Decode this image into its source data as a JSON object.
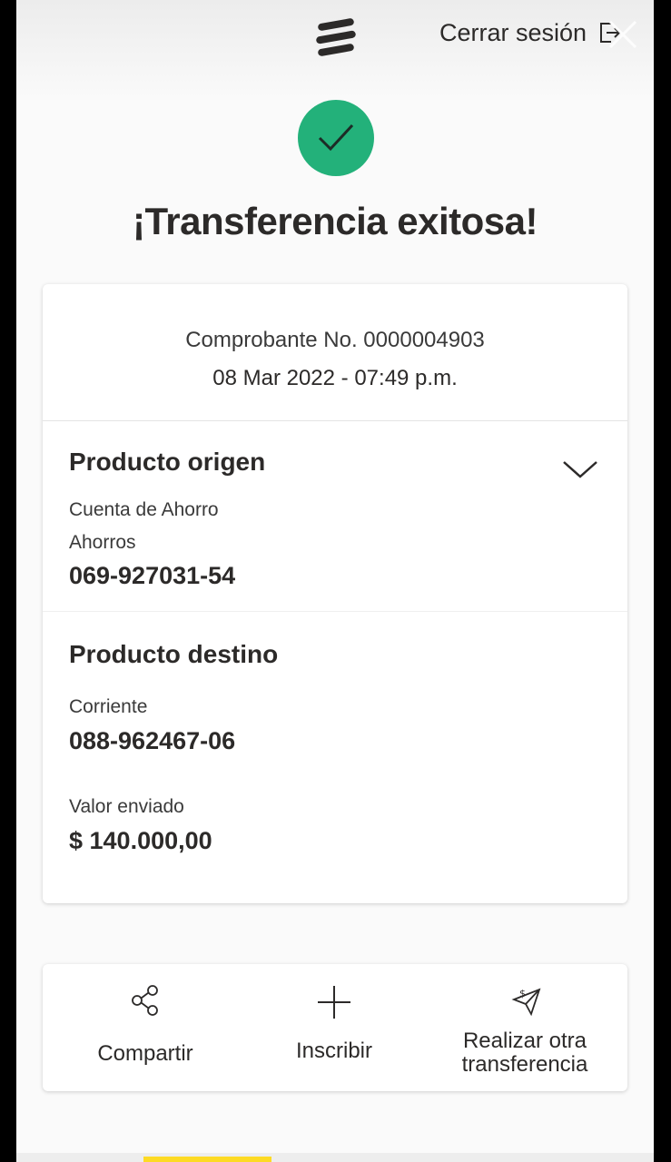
{
  "header": {
    "logout_label": "Cerrar sesión",
    "logo_icon": "bank-logo-icon",
    "logout_icon": "logout-icon",
    "close_icon": "close-icon"
  },
  "status": {
    "icon": "check-icon",
    "color": "#23b17a",
    "title": "¡Transferencia exitosa!"
  },
  "receipt": {
    "number": "Comprobante No. 0000004903",
    "datetime": "08 Mar 2022 - 07:49 p.m."
  },
  "origin": {
    "title": "Producto origen",
    "product_name": "Cuenta de Ahorro",
    "product_type": "Ahorros",
    "account_number": "069-927031-54",
    "toggle_icon": "chevron-down-icon"
  },
  "destination": {
    "title": "Producto destino",
    "product_type": "Corriente",
    "account_number": "088-962467-06",
    "amount_label": "Valor enviado",
    "amount": "$ 140.000,00"
  },
  "actions": [
    {
      "label": "Compartir",
      "icon": "share-icon"
    },
    {
      "label": "Inscribir",
      "icon": "plus-icon"
    },
    {
      "label_line1": "Realizar otra",
      "label_line2": "transferencia",
      "icon": "send-money-icon"
    }
  ],
  "colors": {
    "success": "#23b17a",
    "brand_yellow": "#fdda24",
    "text": "#2c2a29"
  }
}
